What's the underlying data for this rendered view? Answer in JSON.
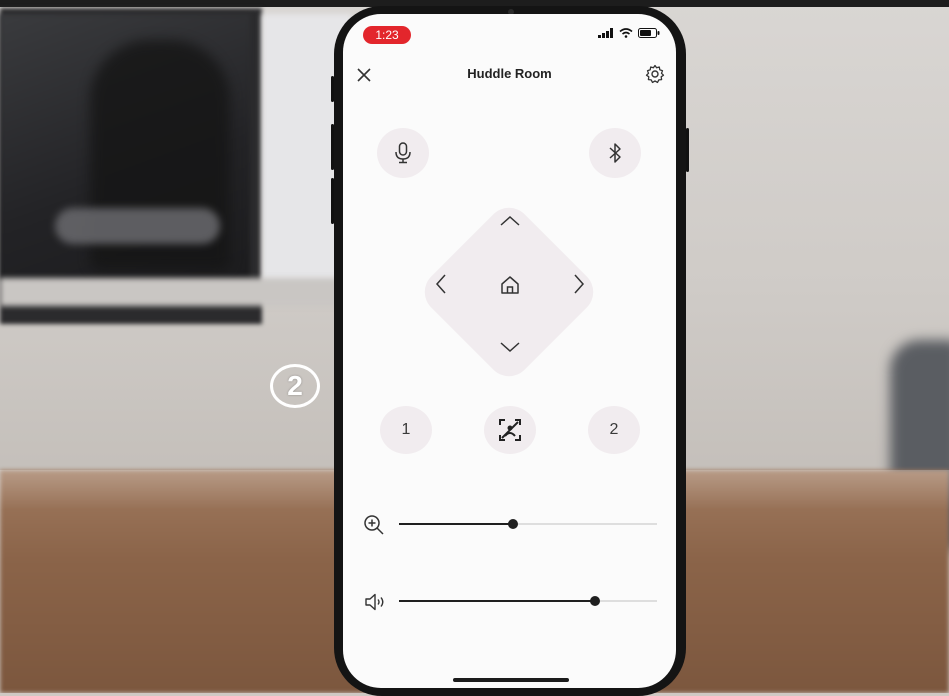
{
  "callout": {
    "number": "2"
  },
  "status_bar": {
    "time": "1:23"
  },
  "header": {
    "title": "Huddle Room"
  },
  "presets": {
    "left_label": "1",
    "right_label": "2"
  },
  "zoom_slider": {
    "value": 0.44
  },
  "volume_slider": {
    "value": 0.76
  },
  "icons": {
    "close": "close-icon",
    "settings": "gear-icon",
    "mic": "microphone-icon",
    "bluetooth": "bluetooth-icon",
    "up": "chevron-up-icon",
    "down": "chevron-down-icon",
    "left": "chevron-left-icon",
    "right": "chevron-right-icon",
    "home": "home-icon",
    "frame": "auto-frame-icon",
    "zoom": "zoom-in-icon",
    "volume": "volume-icon"
  },
  "colors": {
    "status_pill": "#e3262c",
    "button_bg": "#f1ecef",
    "accent": "#1f1f1f"
  }
}
